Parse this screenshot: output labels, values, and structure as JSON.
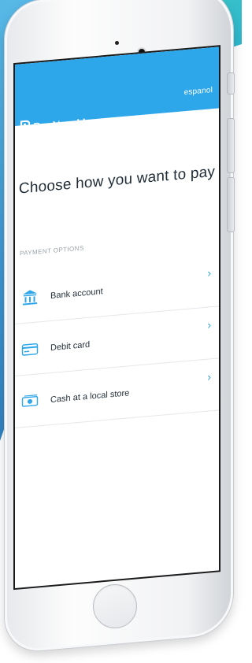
{
  "header": {
    "language_link": "espanol",
    "brand_name": "PayNearMe"
  },
  "main": {
    "heading": "Choose how you want to pay",
    "section_label": "PAYMENT OPTIONS",
    "options": [
      {
        "label": "Bank account",
        "icon": "bank-icon"
      },
      {
        "label": "Debit card",
        "icon": "card-icon"
      },
      {
        "label": "Cash at a local store",
        "icon": "cash-icon"
      }
    ],
    "chevron": "›"
  },
  "colors": {
    "brand_blue": "#2ea6ea",
    "text_dark": "#1f2b35",
    "label_gray": "#9ba4ab"
  }
}
